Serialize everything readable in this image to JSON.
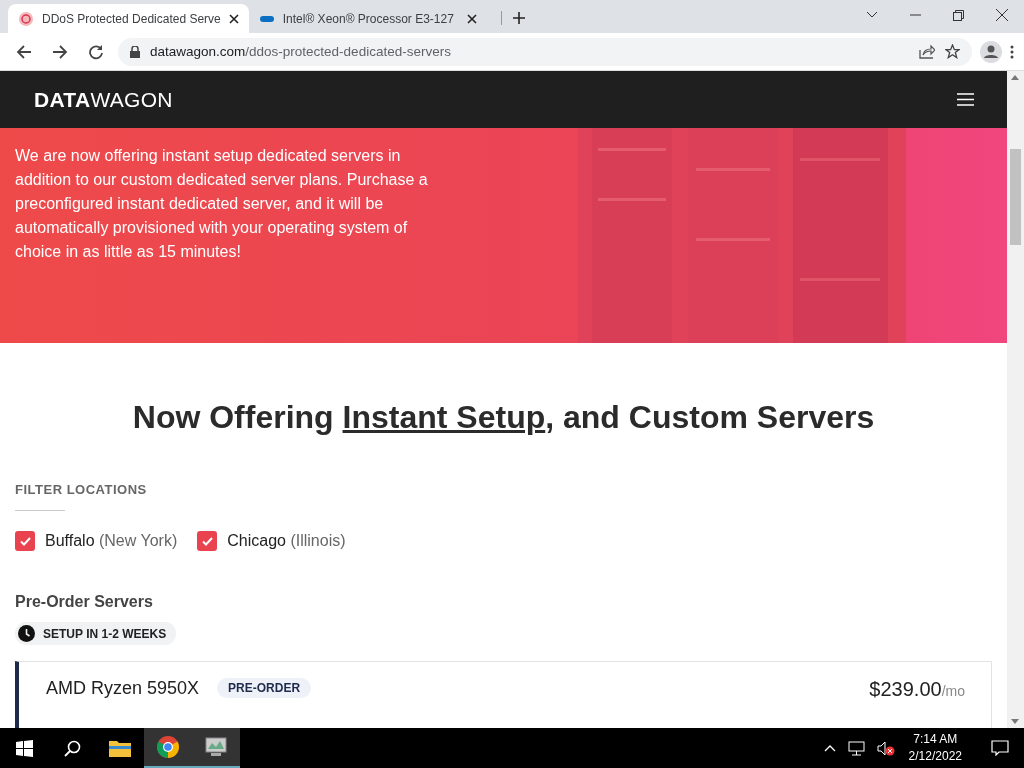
{
  "browser": {
    "tabs": [
      {
        "title": "DDoS Protected Dedicated Serve",
        "selected": true
      },
      {
        "title": "Intel® Xeon® Processor E3-127",
        "selected": false
      }
    ],
    "url": {
      "domain": "datawagon.com",
      "path": "/ddos-protected-dedicated-servers"
    }
  },
  "site": {
    "logo": {
      "bold": "DATA",
      "light": "WAGON"
    }
  },
  "hero": {
    "text": "We are now offering instant setup dedicated servers in addition to our custom dedicated server plans. Purchase a preconfigured instant dedicated server, and it will be automatically provisioned with your operating system of choice in as little as 15 minutes!"
  },
  "headline": {
    "before": "Now Offering ",
    "link": "Instant Setup",
    "after": ", and Custom Servers"
  },
  "filter": {
    "title": "FILTER LOCATIONS",
    "locations": [
      {
        "city": "Buffalo",
        "region": "(New York)",
        "checked": true
      },
      {
        "city": "Chicago",
        "region": "(Illinois)",
        "checked": true
      }
    ]
  },
  "section": {
    "title": "Pre-Order Servers",
    "badge": "SETUP IN 1-2 WEEKS"
  },
  "servers": [
    {
      "name": "AMD Ryzen 5950X",
      "tag": "PRE-ORDER",
      "price": "$239.00",
      "unit": "/mo"
    }
  ],
  "taskbar": {
    "time": "7:14 AM",
    "date": "2/12/2022"
  }
}
